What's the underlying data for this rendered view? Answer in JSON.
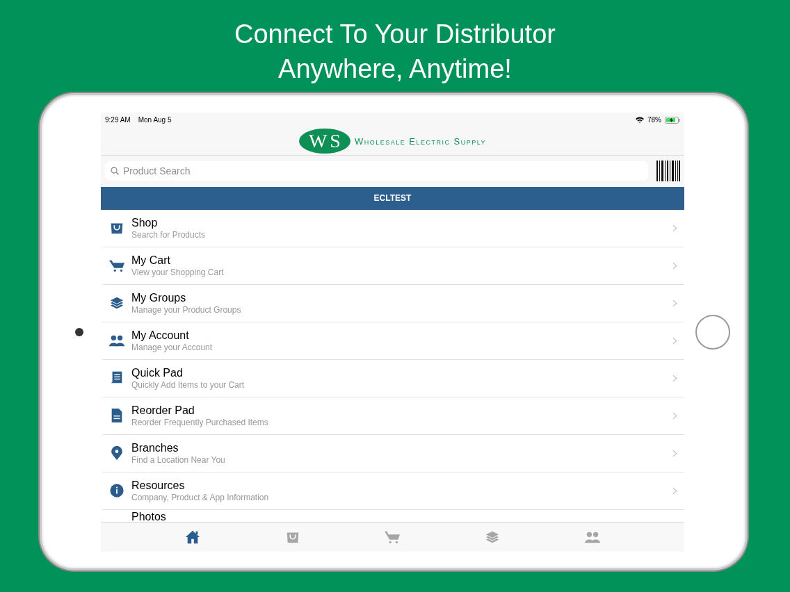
{
  "headline": [
    "Connect To Your Distributor",
    "Anywhere, Anytime!"
  ],
  "status_bar": {
    "time": "9:29 AM",
    "date": "Mon Aug 5",
    "battery": "78%"
  },
  "logo": {
    "mark_letters": [
      "W",
      "S"
    ],
    "name": "Wholesale Electric Supply"
  },
  "search": {
    "placeholder": "Product Search"
  },
  "account_banner": "ECLTEST",
  "menu": [
    {
      "kind": "shop",
      "title": "Shop",
      "subtitle": "Search for Products"
    },
    {
      "kind": "cart",
      "title": "My Cart",
      "subtitle": "View your Shopping Cart"
    },
    {
      "kind": "groups",
      "title": "My Groups",
      "subtitle": "Manage your Product Groups"
    },
    {
      "kind": "account",
      "title": "My Account",
      "subtitle": "Manage your Account"
    },
    {
      "kind": "quickpad",
      "title": "Quick Pad",
      "subtitle": "Quickly Add Items to your Cart"
    },
    {
      "kind": "reorder",
      "title": "Reorder Pad",
      "subtitle": "Reorder Frequently Purchased Items"
    },
    {
      "kind": "branches",
      "title": "Branches",
      "subtitle": "Find a Location Near You"
    },
    {
      "kind": "resources",
      "title": "Resources",
      "subtitle": "Company, Product & App Information"
    },
    {
      "kind": "photos",
      "title": "Photos"
    }
  ],
  "tab_bar": [
    {
      "kind": "home",
      "selected": true
    },
    {
      "kind": "shop",
      "selected": false
    },
    {
      "kind": "cart",
      "selected": false
    },
    {
      "kind": "groups",
      "selected": false
    },
    {
      "kind": "account",
      "selected": false
    }
  ]
}
